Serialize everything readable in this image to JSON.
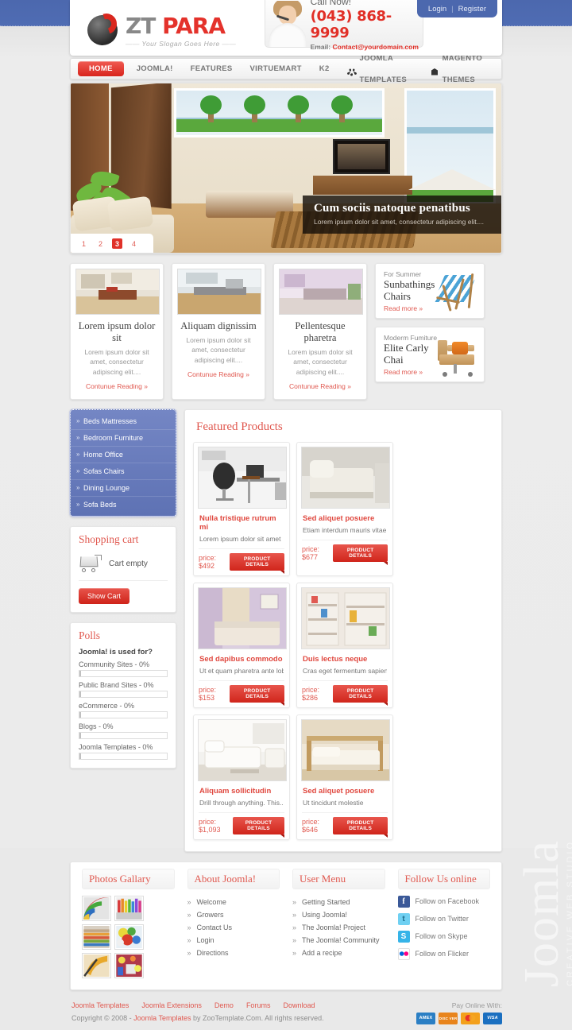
{
  "colors": {
    "accent": "#e0584f",
    "nav_blue": "#4c68ae",
    "red": "#d8241c",
    "menu_blue": "#6478bc"
  },
  "header": {
    "logo_zt": "ZT",
    "logo_para": "PARA",
    "slogan": "Your Slogan Goes Here",
    "call_label": "Call Now!",
    "phone": "(043) 868-9999",
    "email_label": "Email:",
    "email": "Contact@yourdomain.com",
    "login": "Login",
    "separator": "|",
    "register": "Register"
  },
  "nav": {
    "items": [
      {
        "label": "HOME",
        "active": true,
        "icon": ""
      },
      {
        "label": "JOOMLA!",
        "active": false,
        "icon": ""
      },
      {
        "label": "FEATURES",
        "active": false,
        "icon": ""
      },
      {
        "label": "VIRTUEMART",
        "active": false,
        "icon": ""
      },
      {
        "label": "K2",
        "active": false,
        "icon": ""
      },
      {
        "label": "JOOMLA TEMPLATES",
        "active": false,
        "icon": "joomla-icon"
      },
      {
        "label": "MAGENTO THEMES",
        "active": false,
        "icon": "magento-icon"
      }
    ]
  },
  "slider": {
    "caption_title": "Cum sociis natoque penatibus",
    "caption_text": "Lorem ipsum dolor sit amet, consectetur adipiscing elit....",
    "pages": [
      "1",
      "2",
      "3",
      "4"
    ],
    "active_page": "3"
  },
  "promos": [
    {
      "title": "Lorem ipsum dolor sit",
      "text": "Lorem ipsum dolor sit amet, consectetur adipiscing elit....",
      "link": "Contunue Reading"
    },
    {
      "title": "Aliquam dignissim",
      "text": "Lorem ipsum dolor sit amet, consectetur adipiscing elit....",
      "link": "Contunue Reading"
    },
    {
      "title": "Pellentesque pharetra",
      "text": "Lorem ipsum dolor sit amet, consectetur adipiscing elit....",
      "link": "Contunue Reading"
    }
  ],
  "side_promos": [
    {
      "kicker": "For Summer",
      "title": "Sunbathings Chairs",
      "link": "Read more",
      "icon": "deck-chair-icon"
    },
    {
      "kicker": "Moderm Fumiture",
      "title": "Elite Carly Chai",
      "link": "Read more",
      "icon": "office-chair-icon"
    }
  ],
  "vertical_menu": {
    "items": [
      "Beds Mattresses",
      "Bedroom Furniture",
      "Home Office",
      "Sofas Chairs",
      "Dining Lounge",
      "Sofa Beds"
    ]
  },
  "cart": {
    "title": "Shopping cart",
    "empty_text": "Cart empty",
    "button": "Show Cart"
  },
  "polls": {
    "title": "Polls",
    "question": "Joomla! is used for?",
    "options": [
      {
        "label": "Community Sites - 0%",
        "pct": 0
      },
      {
        "label": "Public Brand Sites - 0%",
        "pct": 0
      },
      {
        "label": "eCommerce - 0%",
        "pct": 0
      },
      {
        "label": "Blogs - 0%",
        "pct": 0
      },
      {
        "label": "Joomla Templates - 0%",
        "pct": 0
      }
    ]
  },
  "featured": {
    "title": "Featured Products",
    "button_label": "PRODUCT DETAILS",
    "price_prefix": "price:",
    "products": [
      {
        "name": "Nulla tristique rutrum mi",
        "desc": "Lorem ipsum dolor sit amet",
        "price": "$492",
        "image": "office-desk-chair"
      },
      {
        "name": "Sed aliquet posuere",
        "desc": "Etiam interdum mauris vitae enim...",
        "price": "$677",
        "image": "divan-bed-base"
      },
      {
        "name": "Sed dapibus commodo",
        "desc": "Ut et quam pharetra ante lobortis...",
        "price": "$153",
        "image": "bed-purple-room"
      },
      {
        "name": "Duis lectus neque",
        "desc": "Cras eget fermentum sapien",
        "price": "$286",
        "image": "childrens-shelving"
      },
      {
        "name": "Aliquam sollicitudin",
        "desc": "Drill through anything. This...",
        "price": "$1,093",
        "image": "white-sofa-lounge"
      },
      {
        "name": "Sed aliquet posuere",
        "desc": "Ut tincidunt molestie",
        "price": "$646",
        "image": "wooden-bed-frame"
      }
    ]
  },
  "footer_modules": [
    {
      "title": "Photos Gallary",
      "type": "gallery",
      "images": [
        "rainbow-arcs",
        "color-swatches",
        "pencils",
        "balloons",
        "orange-flower",
        "festival-lights"
      ]
    },
    {
      "title": "About Joomla!",
      "type": "links",
      "items": [
        "Welcome",
        "Growers",
        "Contact Us",
        "Login",
        "Directions"
      ]
    },
    {
      "title": "User Menu",
      "type": "links",
      "items": [
        "Getting Started",
        "Using Joomla!",
        "The Joomla! Project",
        "The Joomla! Community",
        "Add a recipe"
      ]
    },
    {
      "title": "Follow Us online",
      "type": "social",
      "items": [
        {
          "label": "Follow on Facebook",
          "icon": "facebook-icon",
          "glyph": "f",
          "color": "#3b5998"
        },
        {
          "label": "Follow on Twitter",
          "icon": "twitter-icon",
          "glyph": "t",
          "color": "#6fd0f2"
        },
        {
          "label": "Follow on Skype",
          "icon": "skype-icon",
          "glyph": "S",
          "color": "#36b4e8"
        },
        {
          "label": "Follow on Flicker",
          "icon": "flickr-icon",
          "glyph": "",
          "color": "#ffffff"
        }
      ]
    }
  ],
  "bottom": {
    "links": [
      "Joomla Templates",
      "Joomla Extensions",
      "Demo",
      "Forums",
      "Download"
    ],
    "copyright_pre": "Copyright © 2008 - ",
    "copyright_link": "Joomla Templates",
    "copyright_post": " by ZooTemplate.Com. All rights reserved.",
    "pay_label": "Pay Online With:",
    "cards": [
      {
        "label": "AMEX",
        "color": "#2b7fc4"
      },
      {
        "label": "DISC VER",
        "color": "#e8841c"
      },
      {
        "label": "",
        "color": "#f3a01b"
      },
      {
        "label": "VISA",
        "color": "#1a6fc0"
      }
    ]
  },
  "watermark": {
    "text": "Joomla",
    "sub": "CREATIVE WEB STUDIO"
  }
}
